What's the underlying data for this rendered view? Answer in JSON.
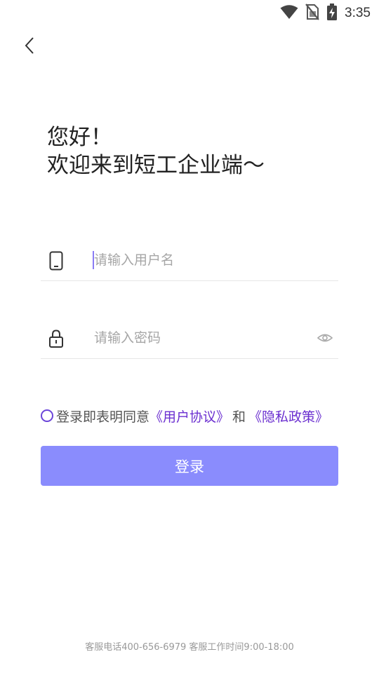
{
  "status_bar": {
    "time": "3:35",
    "icons": [
      "wifi-icon",
      "no-sim-icon",
      "battery-charging-icon"
    ]
  },
  "nav": {
    "back_icon": "chevron-left-icon"
  },
  "greeting": {
    "line1": "您好！",
    "line2": "欢迎来到短工企业端～"
  },
  "form": {
    "username": {
      "icon": "phone-icon",
      "value": "",
      "placeholder": "请输入用户名"
    },
    "password": {
      "icon": "lock-icon",
      "value": "",
      "placeholder": "请输入密码",
      "toggle_icon": "eye-icon"
    }
  },
  "agreement": {
    "prefix": "登录即表明同意",
    "user_agreement": "《用户协议》",
    "joiner": "和",
    "privacy_policy": "《隐私政策》"
  },
  "login_button": {
    "label": "登录"
  },
  "footer": {
    "text": "客服电话400-656-6979 客服工作时间9:00-18:00"
  },
  "colors": {
    "accent": "#8a8cfd",
    "link": "#6b2fd0",
    "caret": "#8a7cf5"
  }
}
